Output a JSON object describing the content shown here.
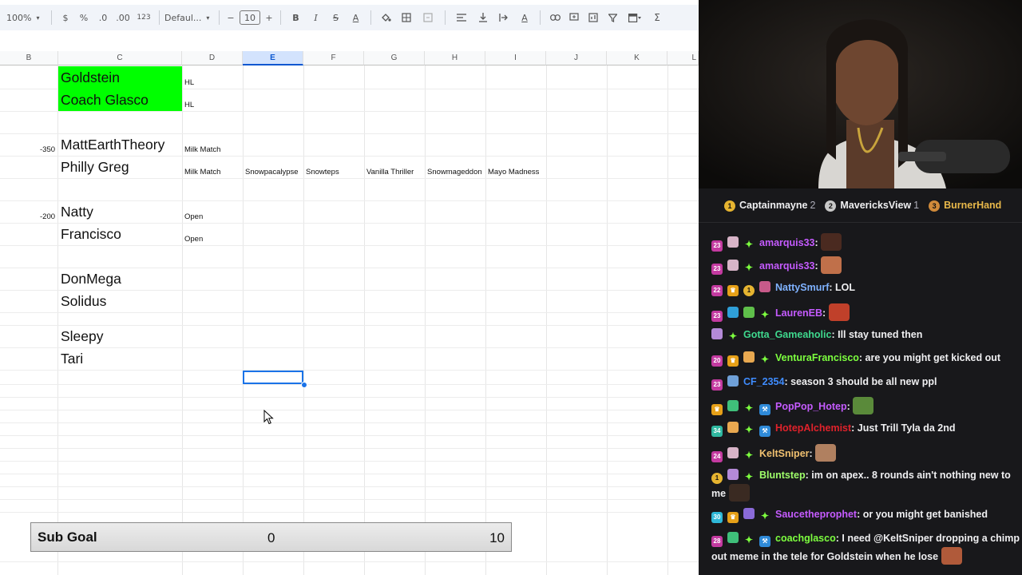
{
  "toolbar": {
    "zoom": "100%",
    "currency": "$",
    "percent": "%",
    "dec_decrease": ".0",
    "dec_increase": ".00",
    "number_format": "123",
    "font": "Defaul...",
    "font_size": "10",
    "bold": "B",
    "italic": "I",
    "strike": "S",
    "text_color": "A",
    "sum": "Σ",
    "minus": "−",
    "plus": "+"
  },
  "columns": [
    "B",
    "C",
    "D",
    "E",
    "F",
    "G",
    "H",
    "I",
    "J",
    "K",
    "L"
  ],
  "active_column": "E",
  "cells": {
    "c_goldstein": "Goldstein",
    "c_coach": "Coach Glasco",
    "d_hl1": "HL",
    "d_hl2": "HL",
    "b_350": "-350",
    "c_matt": "MattEarthTheory",
    "d_milk1": "Milk Match",
    "c_philly": "Philly Greg",
    "d_milk2": "Milk Match",
    "e_snowpac": "Snowpacalypse",
    "f_snowteps": "Snowteps",
    "g_vanilla": "Vanilla Thriller",
    "h_snowmag": "Snowmageddon",
    "i_mayo": "Mayo Madness",
    "b_200": "-200",
    "c_natty": "Natty",
    "d_open1": "Open",
    "c_francisco": "Francisco",
    "d_open2": "Open",
    "c_donmega": "DonMega",
    "c_solidus": "Solidus",
    "c_sleepy": "Sleepy",
    "c_tari": "Tari"
  },
  "sub_goal": {
    "label": "Sub Goal",
    "current": "0",
    "target": "10",
    "progress": 0
  },
  "leaderboard": [
    {
      "rank": "1",
      "name": "Captainmayne",
      "count": "2",
      "color": "#e6b430"
    },
    {
      "rank": "2",
      "name": "MavericksView",
      "count": "1",
      "color": "#c8c8c8"
    },
    {
      "rank": "3",
      "name": "BurnerHand",
      "count": "",
      "color": "#d08a3a"
    }
  ],
  "chat": [
    {
      "user": "amarquis33",
      "color": "#c55bff",
      "text": ""
    },
    {
      "user": "amarquis33",
      "color": "#c55bff",
      "text": ""
    },
    {
      "user": "NattySmurf",
      "color": "#7fb2ff",
      "text": "LOL"
    },
    {
      "user": "LaurenEB",
      "color": "#c55bff",
      "text": ""
    },
    {
      "user": "Gotta_Gameaholic",
      "color": "#3fd98e",
      "text": "Ill stay tuned then"
    },
    {
      "user": "VenturaFrancisco",
      "color": "#7dff3f",
      "text": "are you might get kicked out"
    },
    {
      "user": "CF_2354",
      "color": "#3f8cff",
      "text": "season 3 should be all new ppl"
    },
    {
      "user": "PopPop_Hotep",
      "color": "#c55bff",
      "text": ""
    },
    {
      "user": "HotepAlchemist",
      "color": "#e0222b",
      "text": "Just Trill Tyla da 2nd"
    },
    {
      "user": "KeltSniper",
      "color": "#f0c070",
      "text": ""
    },
    {
      "user": "Bluntstep",
      "color": "#9fff6a",
      "text": "im on apex.. 8 rounds ain't nothing new to me"
    },
    {
      "user": "Saucetheprophet",
      "color": "#c55bff",
      "text": "or you might get banished"
    },
    {
      "user": "coachglasco",
      "color": "#7dff3f",
      "text": "I need @KeltSniper dropping a chimp out meme in the tele for Goldstein when he lose"
    }
  ]
}
